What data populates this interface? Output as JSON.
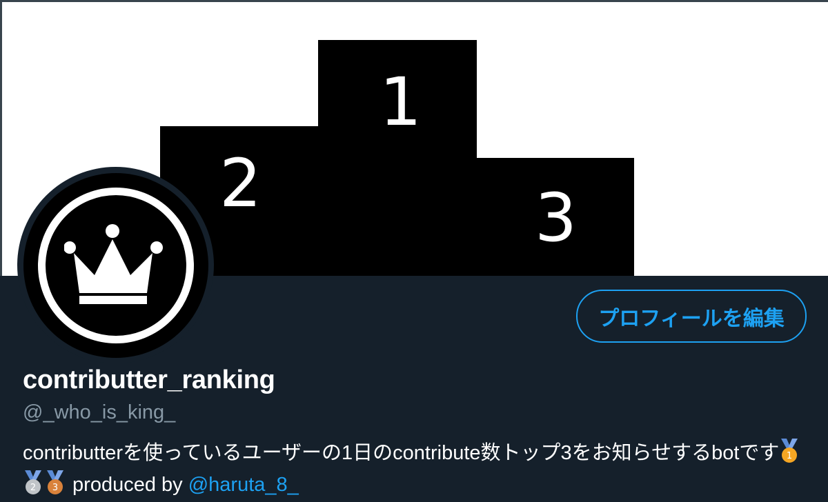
{
  "profile": {
    "display_name": "contributter_ranking",
    "handle": "@_who_is_king_",
    "bio_text": "contributterを使っているユーザーの1日のcontribute数トップ3をお知らせするbotです",
    "bio_suffix": " produced by ",
    "bio_mention": "@haruta_8_",
    "edit_button_label": "プロフィールを編集"
  },
  "banner": {
    "podium_labels": [
      "1",
      "2",
      "3"
    ]
  },
  "medals": [
    {
      "icon": "gold-medal-icon",
      "label": "1",
      "color": "#f5a623"
    },
    {
      "icon": "silver-medal-icon",
      "label": "2",
      "color": "#c0c4c8"
    },
    {
      "icon": "bronze-medal-icon",
      "label": "3",
      "color": "#d9823b"
    }
  ],
  "colors": {
    "background": "#15202b",
    "accent": "#1da1f2",
    "muted": "#8899a6"
  }
}
